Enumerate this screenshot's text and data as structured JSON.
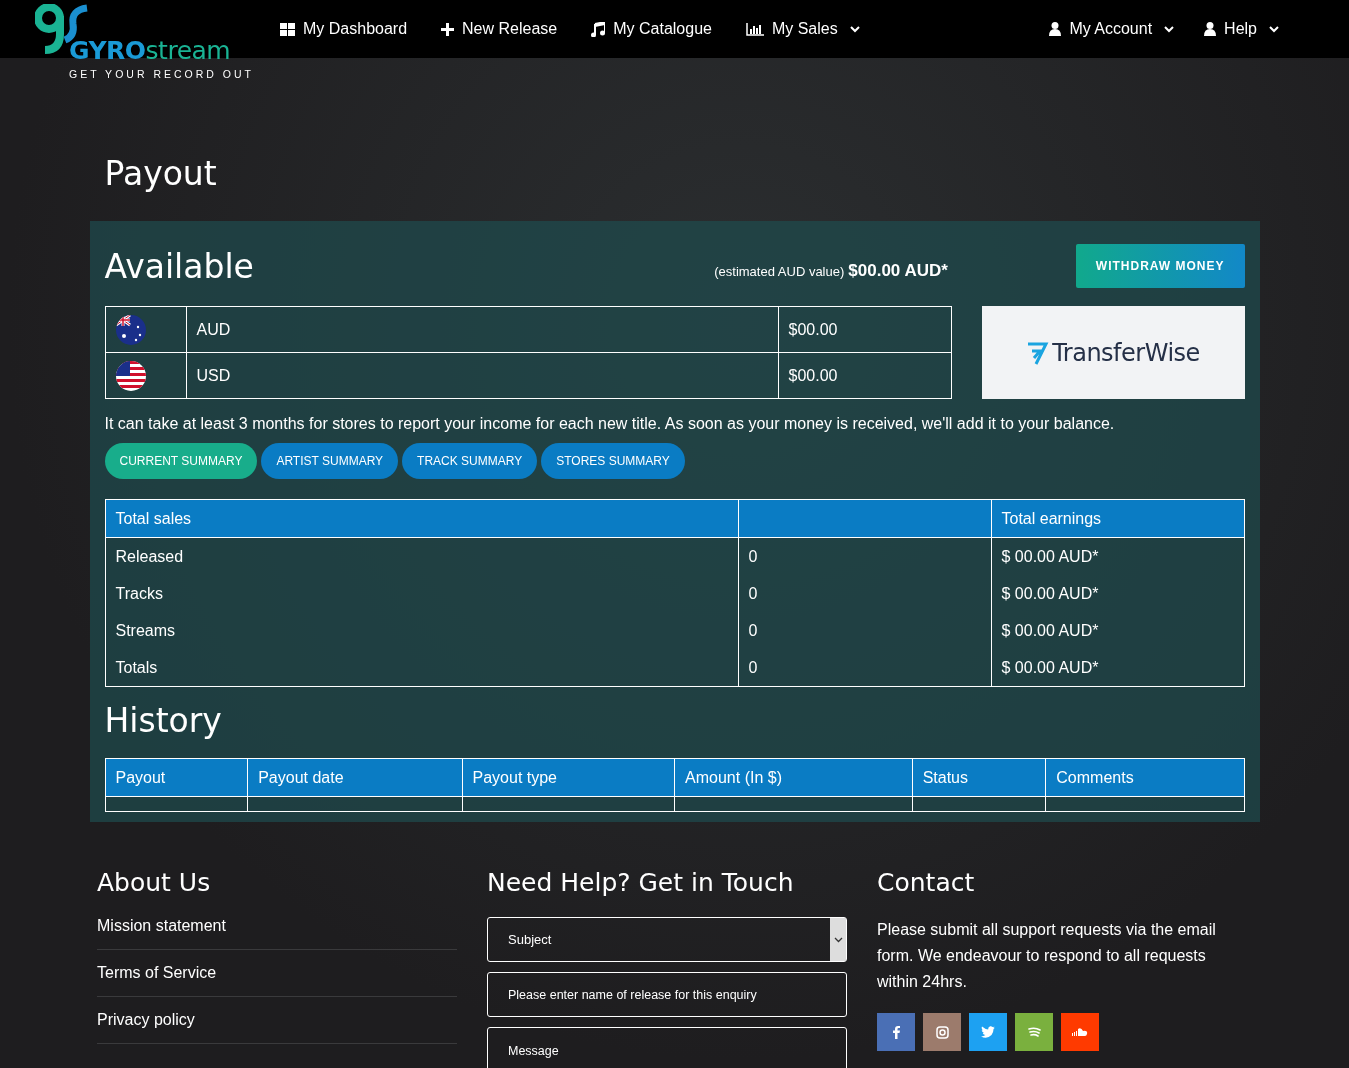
{
  "logo": {
    "brand_bold": "GYRO",
    "brand_light": "stream",
    "tagline": "GET YOUR RECORD OUT"
  },
  "nav": [
    {
      "label": "My Dashboard",
      "kind": "dashboard",
      "dropdown": false
    },
    {
      "label": "New Release",
      "kind": "release",
      "dropdown": false
    },
    {
      "label": "My Catalogue",
      "kind": "catalogue",
      "dropdown": false
    },
    {
      "label": "My Sales",
      "kind": "sales",
      "dropdown": true
    }
  ],
  "nav_right": [
    {
      "label": "My Account",
      "kind": "account",
      "dropdown": true
    },
    {
      "label": "Help",
      "kind": "account",
      "dropdown": true
    }
  ],
  "page_title": "Payout",
  "available": {
    "title": "Available",
    "estimate_label": "(estimated AUD value)",
    "estimate_value": "$00.00 AUD*",
    "withdraw_button": "WITHDRAW MONEY",
    "provider": "TransferWise",
    "currencies": [
      {
        "kind": "australia",
        "code": "AUD",
        "amount": "$00.00"
      },
      {
        "kind": "usa",
        "code": "USD",
        "amount": "$00.00"
      }
    ],
    "note": "It can take at least 3 months for stores to report your income for each new title. As soon as your money is received, we'll add it to your balance."
  },
  "summary_tabs": [
    {
      "label": "CURRENT SUMMARY",
      "selected": true
    },
    {
      "label": "ARTIST SUMMARY",
      "selected": false
    },
    {
      "label": "TRACK SUMMARY",
      "selected": false
    },
    {
      "label": "STORES SUMMARY",
      "selected": false
    }
  ],
  "sales_table": {
    "columns": [
      "Total sales",
      "",
      "Total earnings"
    ],
    "rows": [
      [
        "Released",
        "0",
        "$ 00.00 AUD*"
      ],
      [
        "Tracks",
        "0",
        "$ 00.00 AUD*"
      ],
      [
        "Streams",
        "0",
        "$ 00.00 AUD*"
      ],
      [
        "Totals",
        "0",
        "$ 00.00 AUD*"
      ]
    ]
  },
  "history": {
    "title": "History",
    "columns": [
      "Payout",
      "Payout date",
      "Payout type",
      "Amount (In $)",
      "Status",
      "Comments"
    ]
  },
  "footer": {
    "about": {
      "title": "About Us",
      "links": [
        "Mission statement",
        "Terms of Service",
        "Privacy policy"
      ]
    },
    "help": {
      "title": "Need Help? Get in Touch",
      "subject_placeholder": "Subject",
      "release_placeholder": "Please enter name of release for this enquiry",
      "message_placeholder": "Message"
    },
    "contact": {
      "title": "Contact",
      "text": "Please submit all support requests via the email form. We endeavour to respond to all requests within 24hrs.",
      "social": [
        {
          "kind": "facebook",
          "color": "#4a6fb5"
        },
        {
          "kind": "instagram",
          "color": "#9c7b6c"
        },
        {
          "kind": "twitter",
          "color": "#1da1f2"
        },
        {
          "kind": "spotify",
          "color": "#7ab03e"
        },
        {
          "kind": "soundcloud",
          "color": "#ff3a00"
        }
      ]
    }
  }
}
